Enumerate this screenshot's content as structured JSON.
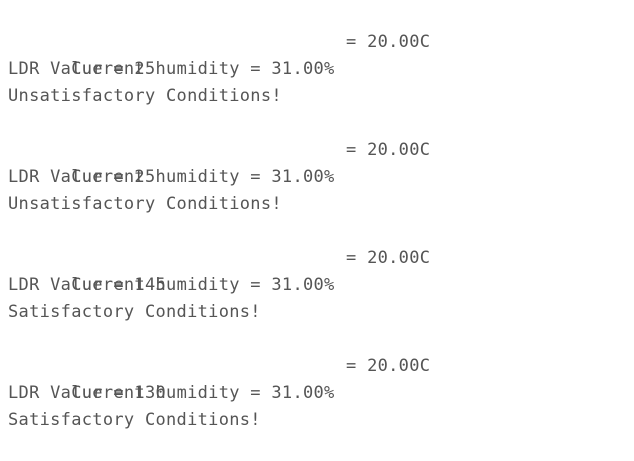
{
  "console": {
    "blocks": [
      {
        "humidity_text": "Current humidity = 31.00%",
        "temp_text": "= 20.00C",
        "ldr_text": "LDR Value = 25",
        "status_text": "Unsatisfactory Conditions!"
      },
      {
        "humidity_text": "Current humidity = 31.00%",
        "temp_text": "= 20.00C",
        "ldr_text": "LDR Value = 25",
        "status_text": "Unsatisfactory Conditions!"
      },
      {
        "humidity_text": "Current humidity = 31.00%",
        "temp_text": "= 20.00C",
        "ldr_text": "LDR Value = 145",
        "status_text": "Satisfactory Conditions!"
      },
      {
        "humidity_text": "Current humidity = 31.00%",
        "temp_text": "= 20.00C",
        "ldr_text": "LDR Value = 130",
        "status_text": "Satisfactory Conditions!"
      }
    ]
  },
  "colors": {
    "text": "#555555",
    "background": "#ffffff"
  }
}
